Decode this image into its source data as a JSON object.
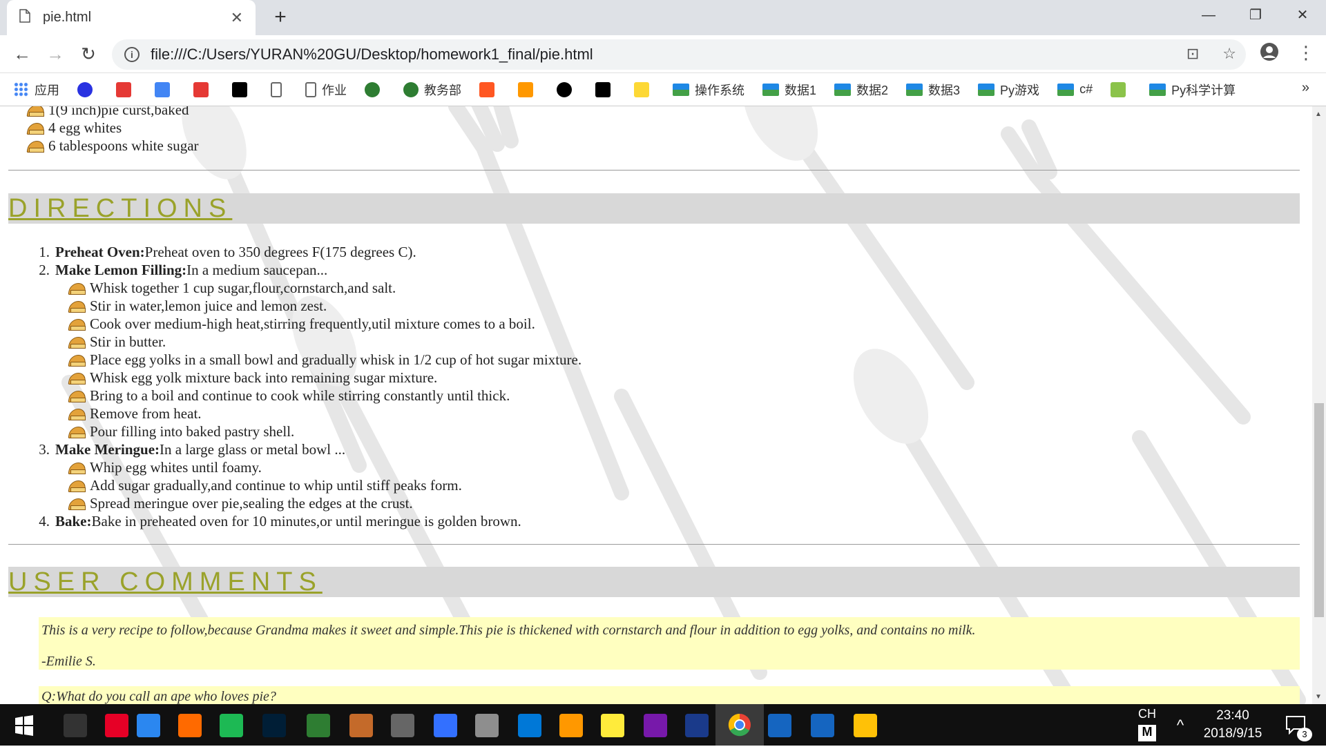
{
  "browser": {
    "tab_title": "pie.html",
    "tab_close": "✕",
    "new_tab": "+",
    "url": "file:///C:/Users/YURAN%20GU/Desktop/homework1_final/pie.html",
    "win_min": "—",
    "win_restore": "❐",
    "win_close": "✕",
    "bookmarks": [
      {
        "label": "应用",
        "icon": "apps-grid-icon",
        "color": "#4285f4"
      },
      {
        "label": "",
        "icon": "baidu-paw-icon",
        "color": "#2932e1"
      },
      {
        "label": "",
        "icon": "red-logo-icon",
        "color": "#e53935"
      },
      {
        "label": "",
        "icon": "google-translate-icon",
        "color": "#4285f4"
      },
      {
        "label": "",
        "icon": "c-logo-icon",
        "color": "#e53935"
      },
      {
        "label": "",
        "icon": "sf-logo-icon",
        "color": "#000000"
      },
      {
        "label": "",
        "icon": "page-icon",
        "color": "#666666"
      },
      {
        "label": "作业",
        "icon": "page-icon",
        "color": "#666666"
      },
      {
        "label": "",
        "icon": "university-seal-icon",
        "color": "#2e7d32"
      },
      {
        "label": "教务部",
        "icon": "university-seal-icon",
        "color": "#2e7d32"
      },
      {
        "label": "",
        "icon": "orange-logo-icon",
        "color": "#ff5722"
      },
      {
        "label": "",
        "icon": "code-logo-icon",
        "color": "#ff9800"
      },
      {
        "label": "",
        "icon": "github-icon",
        "color": "#000000"
      },
      {
        "label": "",
        "icon": "wikipedia-icon",
        "color": "#000000"
      },
      {
        "label": "",
        "icon": "emoji-logo-icon",
        "color": "#fdd835"
      },
      {
        "label": "操作系统",
        "icon": "folder-icon",
        "color": "#1e88e5"
      },
      {
        "label": "数据1",
        "icon": "folder-icon",
        "color": "#1e88e5"
      },
      {
        "label": "数据2",
        "icon": "folder-icon",
        "color": "#1e88e5"
      },
      {
        "label": "数据3",
        "icon": "folder-icon",
        "color": "#1e88e5"
      },
      {
        "label": "Py游戏",
        "icon": "folder-icon",
        "color": "#1e88e5"
      },
      {
        "label": "c#",
        "icon": "folder-icon",
        "color": "#1e88e5"
      },
      {
        "label": "",
        "icon": "green-logo-icon",
        "color": "#8bc34a"
      },
      {
        "label": "Py科学计算",
        "icon": "folder-icon",
        "color": "#1e88e5"
      }
    ],
    "bookmarks_more": "»"
  },
  "ingredients_tail": [
    "1(9 inch)pie curst,baked",
    "4 egg whites",
    "6 tablespoons white sugar"
  ],
  "directions": {
    "heading": "DIRECTIONS",
    "steps": [
      {
        "num": "1.",
        "title": "Preheat Oven:",
        "text": "Preheat oven to 350 degrees F(175 degrees C).",
        "sub": []
      },
      {
        "num": "2.",
        "title": "Make Lemon Filling:",
        "text": "In a medium saucepan...",
        "sub": [
          "Whisk together 1 cup sugar,flour,cornstarch,and salt.",
          "Stir in water,lemon juice and lemon zest.",
          "Cook over medium-high heat,stirring frequently,util mixture comes to a boil.",
          "Stir in butter.",
          "Place egg yolks in a small bowl and gradually whisk in 1/2 cup of hot sugar mixture.",
          "Whisk egg yolk mixture back into remaining sugar mixture.",
          "Bring to a boil and continue to cook while stirring constantly until thick.",
          "Remove from heat.",
          "Pour filling into baked pastry shell."
        ]
      },
      {
        "num": "3.",
        "title": "Make Meringue:",
        "text": "In a large glass or metal bowl ...",
        "sub": [
          "Whip egg whites until foamy.",
          "Add sugar gradually,and continue to whip until stiff peaks form.",
          "Spread meringue over pie,sealing the edges at the crust."
        ]
      },
      {
        "num": "4.",
        "title": "Bake:",
        "text": "Bake in preheated oven for 10 minutes,or until meringue is golden brown.",
        "sub": []
      }
    ]
  },
  "comments": {
    "heading": "USER COMMENTS",
    "items": [
      "This is a very recipe to follow,because Grandma makes it sweet and simple.This pie is thickened with cornstarch and flour in addition to egg yolks, and contains no milk.",
      "-Emilie S.",
      "Q:What do you call an ape who loves pie?"
    ]
  },
  "taskbar": {
    "lang": "CH",
    "ime": "M",
    "time": "23:40",
    "date": "2018/9/15",
    "notif_count": "3",
    "icons": [
      {
        "name": "start-icon",
        "color": "#ffffff"
      },
      {
        "name": "terminal-icon",
        "color": "#333333"
      },
      {
        "name": "netease-music-icon",
        "color": "#e60026"
      },
      {
        "name": "wps-writer-icon",
        "color": "#2b87f0"
      },
      {
        "name": "wps-presentation-icon",
        "color": "#ff6a00"
      },
      {
        "name": "wps-spreadsheet-icon",
        "color": "#1db954"
      },
      {
        "name": "photoshop-icon",
        "color": "#001e36"
      },
      {
        "name": "game-icon",
        "color": "#2e7d32"
      },
      {
        "name": "chess-icon",
        "color": "#c46a2a"
      },
      {
        "name": "starcraft-icon",
        "color": "#666666"
      },
      {
        "name": "feishu-icon",
        "color": "#3370ff"
      },
      {
        "name": "paint-icon",
        "color": "#8e8e8e"
      },
      {
        "name": "edge-icon",
        "color": "#0078d7"
      },
      {
        "name": "sublime-icon",
        "color": "#ff9800"
      },
      {
        "name": "notes-icon",
        "color": "#ffeb3b"
      },
      {
        "name": "onenote-icon",
        "color": "#7719aa"
      },
      {
        "name": "devcpp-icon",
        "color": "#1a3a8a"
      },
      {
        "name": "chrome-icon",
        "color": "#34a853"
      },
      {
        "name": "photos-icon",
        "color": "#1565c0"
      },
      {
        "name": "xcode-icon",
        "color": "#1565c0"
      },
      {
        "name": "file-explorer-icon",
        "color": "#ffc107"
      }
    ]
  }
}
